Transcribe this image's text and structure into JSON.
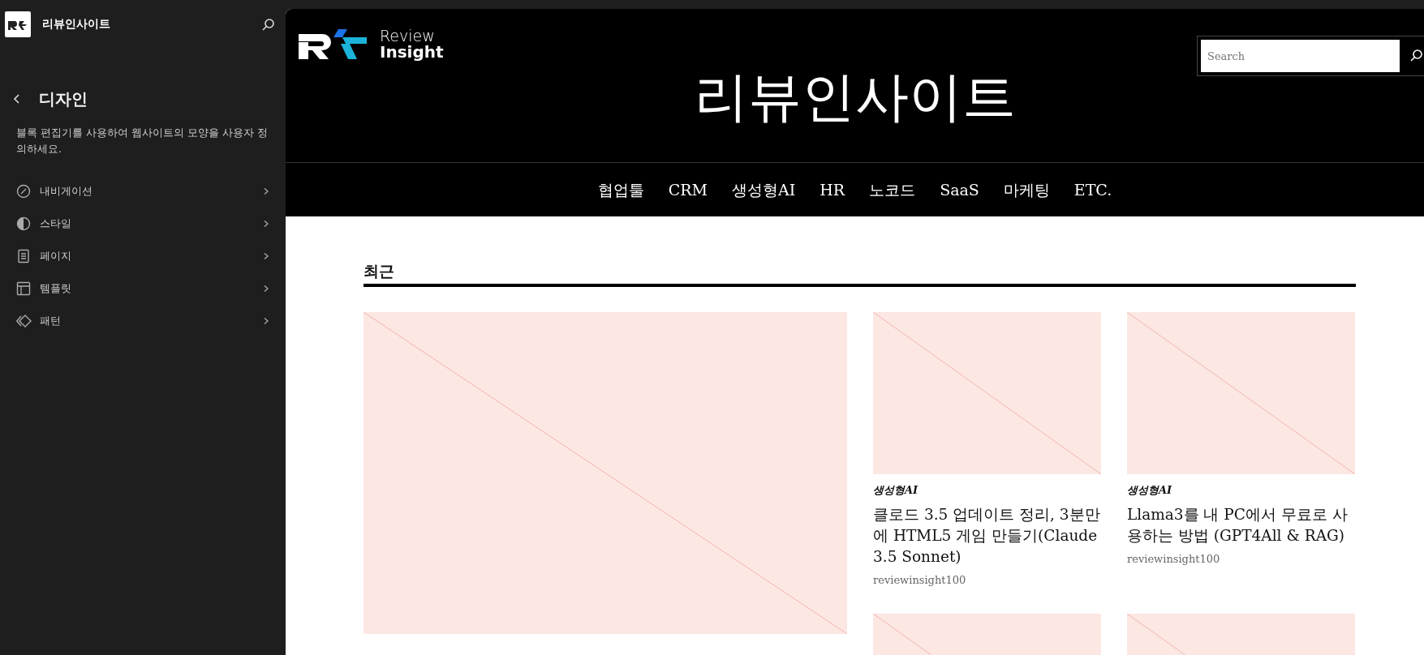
{
  "sidebar": {
    "site_title": "리뷰인사이트",
    "heading": "디자인",
    "description": "블록 편집기를 사용하여 웹사이트의 모양을 사용자 정의하세요.",
    "items": [
      {
        "label": "내비게이션"
      },
      {
        "label": "스타일"
      },
      {
        "label": "페이지"
      },
      {
        "label": "템플릿"
      },
      {
        "label": "패턴"
      }
    ]
  },
  "preview": {
    "logo": {
      "line_1": "Review",
      "line_2": "Insight"
    },
    "search": {
      "placeholder": "Search"
    },
    "site_title": "리뷰인사이트",
    "nav": [
      "협업툴",
      "CRM",
      "생성형AI",
      "HR",
      "노코드",
      "SaaS",
      "마케팅",
      "ETC."
    ],
    "section_title": "최근",
    "posts": [
      {
        "kind": "featured"
      },
      {
        "kind": "card",
        "category": "생성형AI",
        "title": "클로드 3.5 업데이트 정리, 3분만에 HTML5 게임 만들기(Claude 3.5 Sonnet)",
        "author": "reviewinsight100"
      },
      {
        "kind": "card",
        "category": "생성형AI",
        "title": "Llama3를 내 PC에서 무료로 사용하는 방법 (GPT4All & RAG)",
        "author": "reviewinsight100"
      },
      {
        "kind": "card"
      },
      {
        "kind": "card"
      }
    ]
  }
}
